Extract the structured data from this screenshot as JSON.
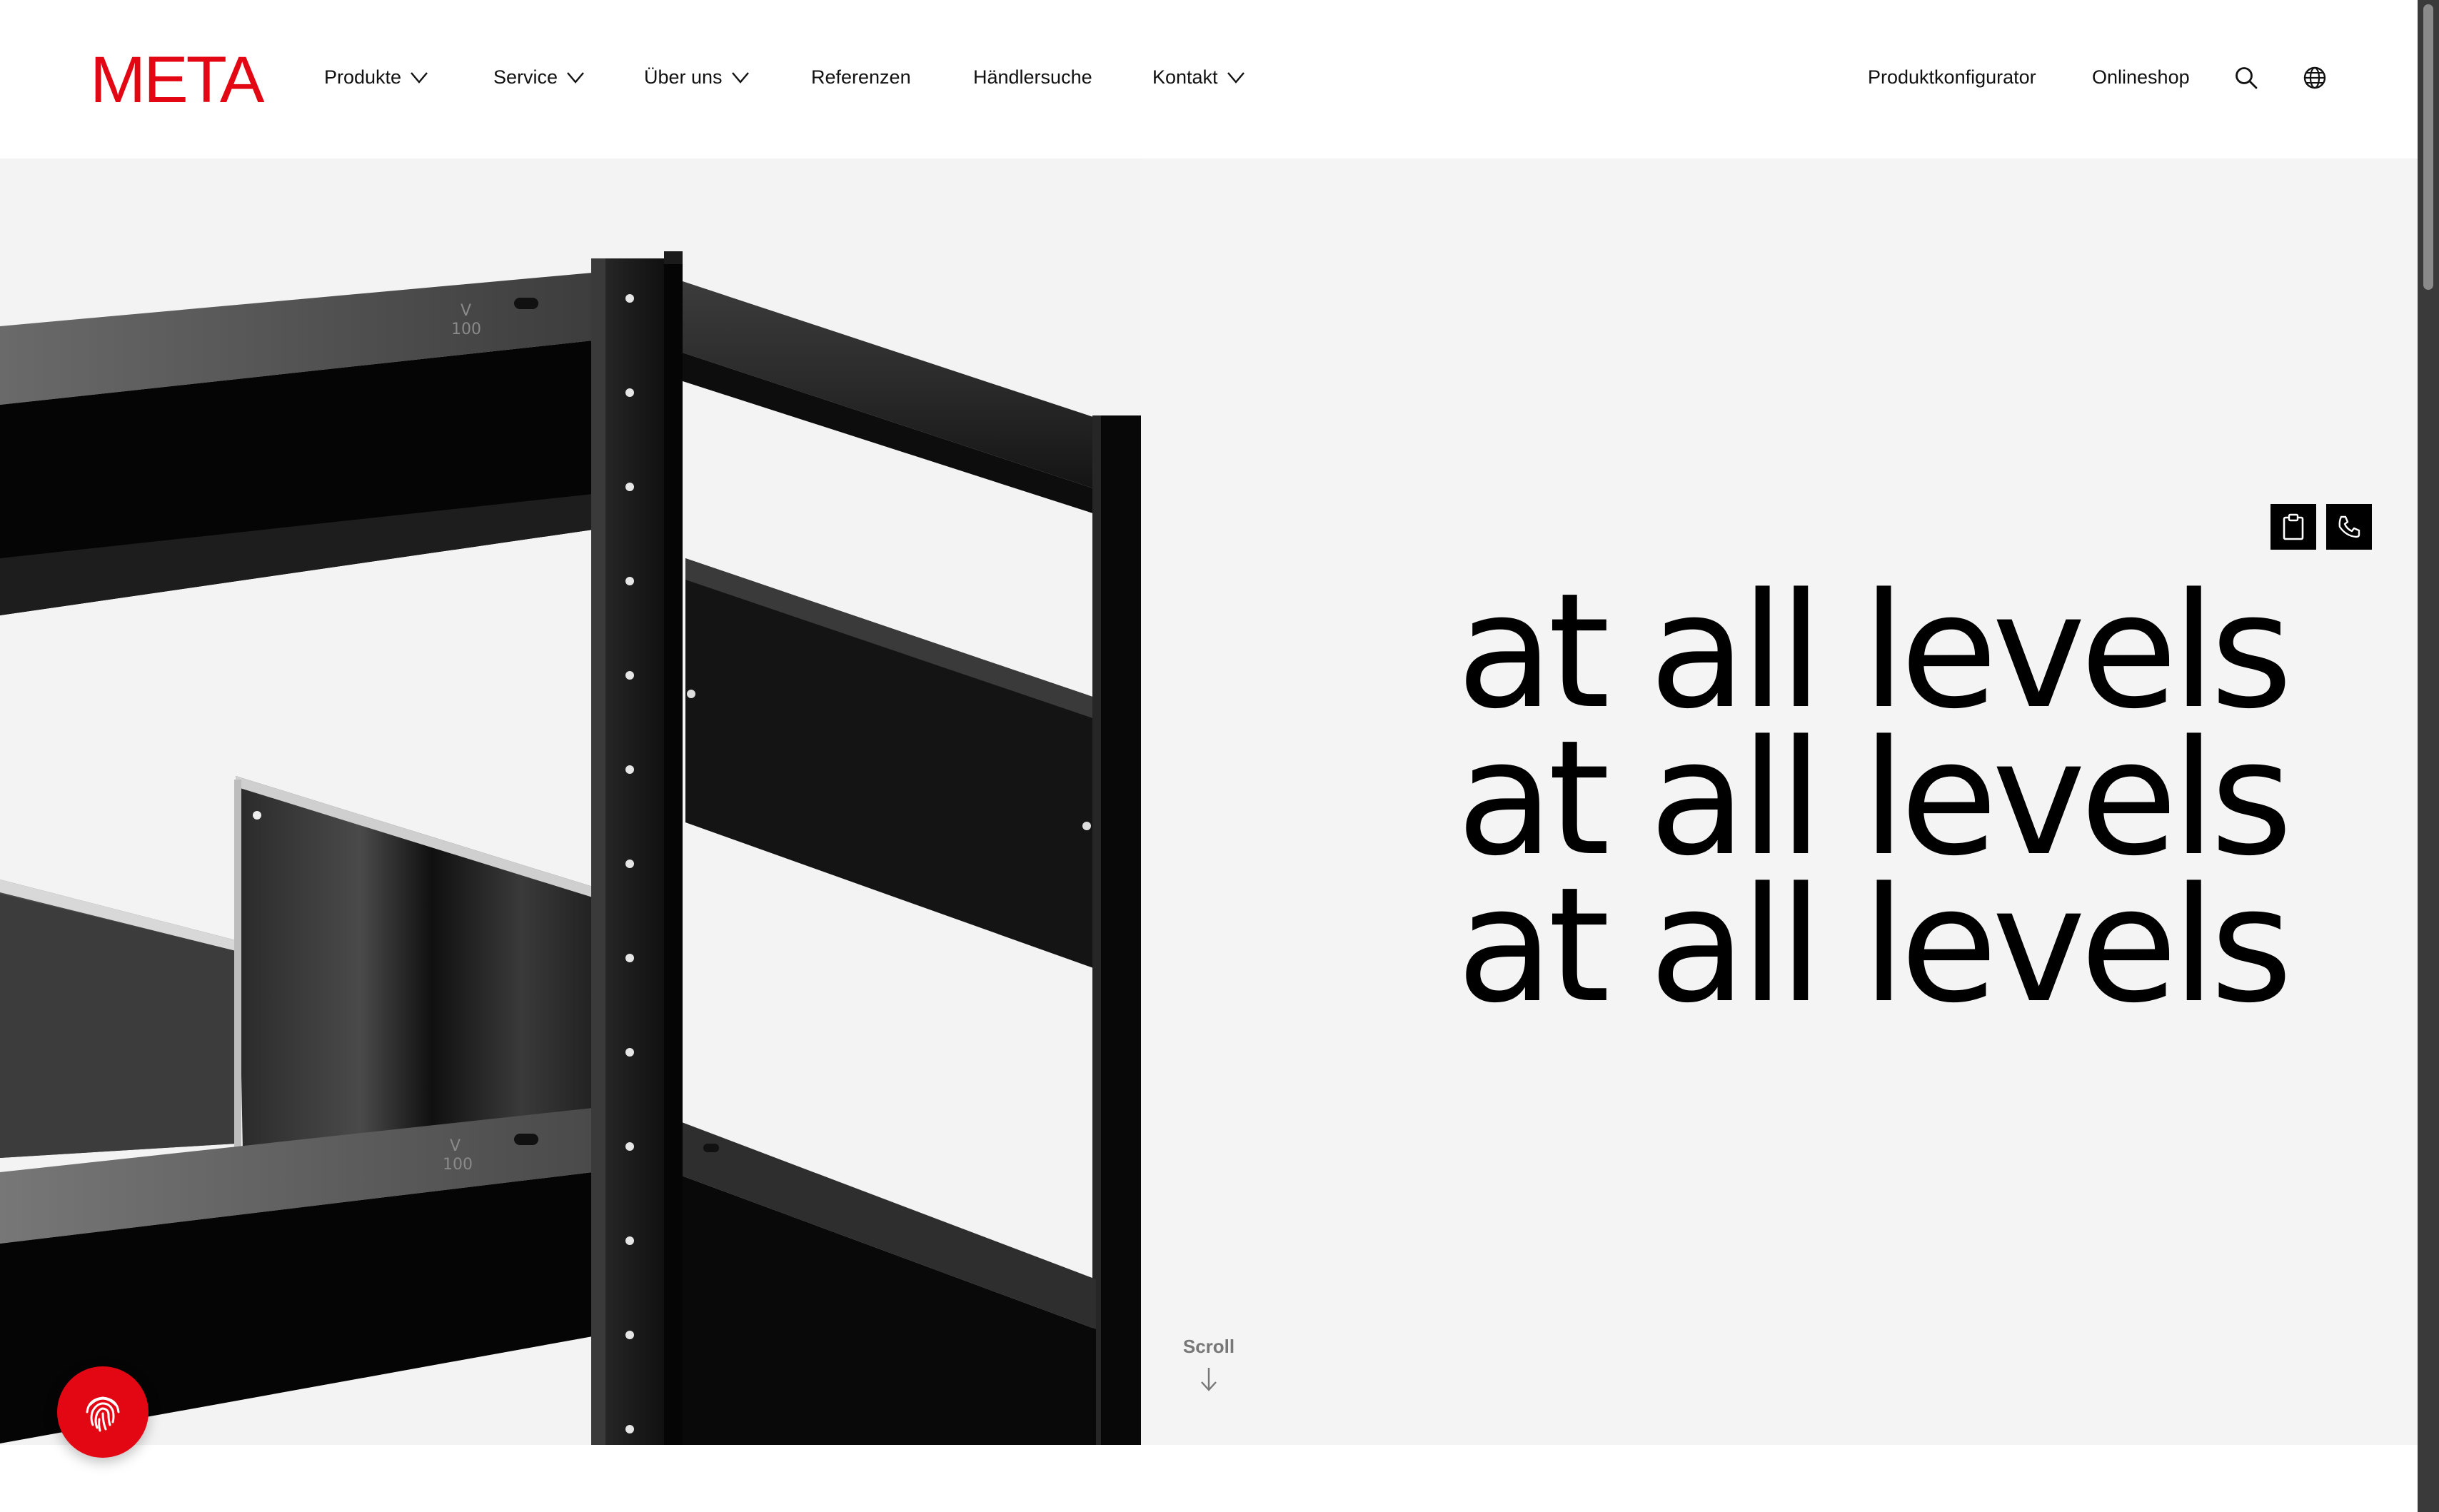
{
  "brand": {
    "logo_text": "META",
    "accent_color": "#e30613"
  },
  "nav": {
    "items": [
      {
        "label": "Produkte",
        "has_dropdown": true
      },
      {
        "label": "Service",
        "has_dropdown": true
      },
      {
        "label": "Über uns",
        "has_dropdown": true
      },
      {
        "label": "Referenzen",
        "has_dropdown": false
      },
      {
        "label": "Händlersuche",
        "has_dropdown": false
      },
      {
        "label": "Kontakt",
        "has_dropdown": true
      }
    ],
    "right_links": [
      {
        "label": "Produktkonfigurator"
      },
      {
        "label": "Onlineshop"
      }
    ],
    "icons": [
      "search-icon",
      "globe-icon"
    ]
  },
  "hero": {
    "headline_lines": [
      "at all levels",
      "at all levels",
      "at all levels"
    ],
    "quick_actions": [
      "clipboard-icon",
      "phone-icon"
    ],
    "scroll_label": "Scroll"
  },
  "floating": {
    "icon": "fingerprint-icon"
  }
}
